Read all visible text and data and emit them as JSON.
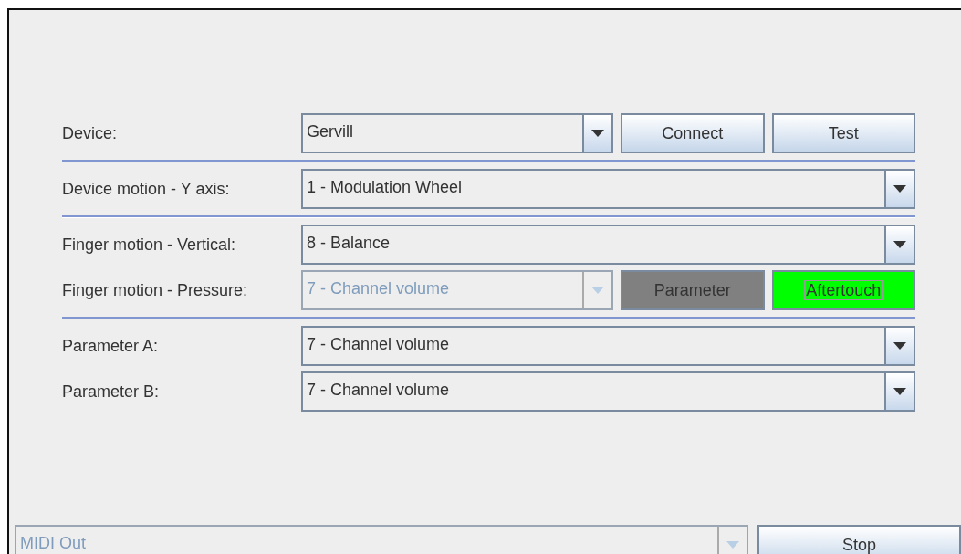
{
  "groups": [
    {
      "rows": [
        {
          "label": "Device:",
          "combo": {
            "value": "Gervill",
            "disabled": false
          },
          "buttons": [
            {
              "label": "Connect",
              "kind": "plain"
            },
            {
              "label": "Test",
              "kind": "plain"
            }
          ]
        }
      ]
    },
    {
      "rows": [
        {
          "label": "Device motion - Y axis:",
          "combo": {
            "value": "1 - Modulation Wheel",
            "disabled": false
          }
        }
      ]
    },
    {
      "rows": [
        {
          "label": "Finger motion - Vertical:",
          "combo": {
            "value": "8 - Balance",
            "disabled": false
          }
        },
        {
          "label": "Finger motion - Pressure:",
          "combo": {
            "value": "7 - Channel volume",
            "disabled": true
          },
          "buttons": [
            {
              "label": "Parameter",
              "kind": "toggle",
              "selected": false
            },
            {
              "label": "Aftertouch",
              "kind": "toggle",
              "selected": true
            }
          ]
        }
      ]
    },
    {
      "rows": [
        {
          "label": "Parameter A:",
          "combo": {
            "value": "7 - Channel volume",
            "disabled": false
          }
        },
        {
          "label": "Parameter B:",
          "combo": {
            "value": "7 - Channel volume",
            "disabled": false
          }
        }
      ]
    }
  ],
  "bottom": {
    "combo": {
      "value": "MIDI Out",
      "disabled": true
    },
    "button": "Stop"
  }
}
